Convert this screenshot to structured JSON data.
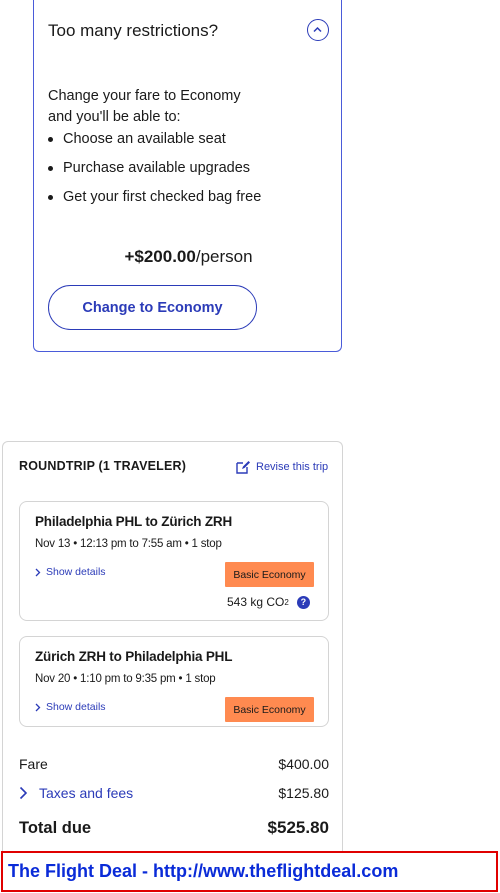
{
  "upsell": {
    "title": "Too many restrictions?",
    "description": "Change your fare to Economy and you'll be able to:",
    "benefits": [
      "Choose an available seat",
      "Purchase available upgrades",
      "Get your first checked bag free"
    ],
    "price": "+$200.00",
    "price_suffix": "/person",
    "button_label": "Change to Economy",
    "collapse_icon": "chevron-up-icon"
  },
  "trip": {
    "header": "ROUNDTRIP (1 TRAVELER)",
    "revise_label": "Revise this trip",
    "legs": [
      {
        "route": "Philadelphia PHL to Zürich ZRH",
        "schedule": "Nov 13 • 12:13 pm to 7:55 am • 1 stop",
        "details_label": "Show details",
        "fare_class": "Basic Economy",
        "co2_value": "543 kg CO",
        "co2_sub": "2"
      },
      {
        "route": "Zürich ZRH to Philadelphia PHL",
        "schedule": "Nov 20 • 1:10 pm to 9:35 pm • 1 stop",
        "details_label": "Show details",
        "fare_class": "Basic Economy"
      }
    ],
    "fare_label": "Fare",
    "fare_amount": "$400.00",
    "taxes_label": "Taxes and fees",
    "taxes_amount": "$125.80",
    "total_label": "Total due",
    "total_amount": "$525.80"
  },
  "banner": {
    "text": "The Flight Deal - http://www.theflightdeal.com"
  },
  "colors": {
    "accent": "#2b3bb8",
    "fare_badge": "#ff8a50",
    "banner_text": "#0a2bd8",
    "banner_border": "#e00000"
  }
}
